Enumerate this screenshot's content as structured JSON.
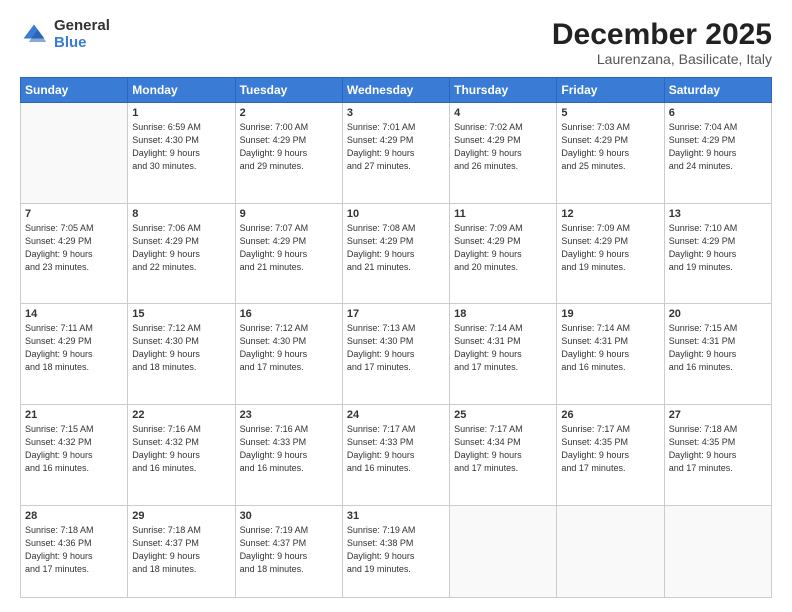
{
  "logo": {
    "general": "General",
    "blue": "Blue"
  },
  "header": {
    "month": "December 2025",
    "location": "Laurenzana, Basilicate, Italy"
  },
  "weekdays": [
    "Sunday",
    "Monday",
    "Tuesday",
    "Wednesday",
    "Thursday",
    "Friday",
    "Saturday"
  ],
  "weeks": [
    [
      {
        "day": "",
        "info": ""
      },
      {
        "day": "1",
        "info": "Sunrise: 6:59 AM\nSunset: 4:30 PM\nDaylight: 9 hours\nand 30 minutes."
      },
      {
        "day": "2",
        "info": "Sunrise: 7:00 AM\nSunset: 4:29 PM\nDaylight: 9 hours\nand 29 minutes."
      },
      {
        "day": "3",
        "info": "Sunrise: 7:01 AM\nSunset: 4:29 PM\nDaylight: 9 hours\nand 27 minutes."
      },
      {
        "day": "4",
        "info": "Sunrise: 7:02 AM\nSunset: 4:29 PM\nDaylight: 9 hours\nand 26 minutes."
      },
      {
        "day": "5",
        "info": "Sunrise: 7:03 AM\nSunset: 4:29 PM\nDaylight: 9 hours\nand 25 minutes."
      },
      {
        "day": "6",
        "info": "Sunrise: 7:04 AM\nSunset: 4:29 PM\nDaylight: 9 hours\nand 24 minutes."
      }
    ],
    [
      {
        "day": "7",
        "info": "Sunrise: 7:05 AM\nSunset: 4:29 PM\nDaylight: 9 hours\nand 23 minutes."
      },
      {
        "day": "8",
        "info": "Sunrise: 7:06 AM\nSunset: 4:29 PM\nDaylight: 9 hours\nand 22 minutes."
      },
      {
        "day": "9",
        "info": "Sunrise: 7:07 AM\nSunset: 4:29 PM\nDaylight: 9 hours\nand 21 minutes."
      },
      {
        "day": "10",
        "info": "Sunrise: 7:08 AM\nSunset: 4:29 PM\nDaylight: 9 hours\nand 21 minutes."
      },
      {
        "day": "11",
        "info": "Sunrise: 7:09 AM\nSunset: 4:29 PM\nDaylight: 9 hours\nand 20 minutes."
      },
      {
        "day": "12",
        "info": "Sunrise: 7:09 AM\nSunset: 4:29 PM\nDaylight: 9 hours\nand 19 minutes."
      },
      {
        "day": "13",
        "info": "Sunrise: 7:10 AM\nSunset: 4:29 PM\nDaylight: 9 hours\nand 19 minutes."
      }
    ],
    [
      {
        "day": "14",
        "info": "Sunrise: 7:11 AM\nSunset: 4:29 PM\nDaylight: 9 hours\nand 18 minutes."
      },
      {
        "day": "15",
        "info": "Sunrise: 7:12 AM\nSunset: 4:30 PM\nDaylight: 9 hours\nand 18 minutes."
      },
      {
        "day": "16",
        "info": "Sunrise: 7:12 AM\nSunset: 4:30 PM\nDaylight: 9 hours\nand 17 minutes."
      },
      {
        "day": "17",
        "info": "Sunrise: 7:13 AM\nSunset: 4:30 PM\nDaylight: 9 hours\nand 17 minutes."
      },
      {
        "day": "18",
        "info": "Sunrise: 7:14 AM\nSunset: 4:31 PM\nDaylight: 9 hours\nand 17 minutes."
      },
      {
        "day": "19",
        "info": "Sunrise: 7:14 AM\nSunset: 4:31 PM\nDaylight: 9 hours\nand 16 minutes."
      },
      {
        "day": "20",
        "info": "Sunrise: 7:15 AM\nSunset: 4:31 PM\nDaylight: 9 hours\nand 16 minutes."
      }
    ],
    [
      {
        "day": "21",
        "info": "Sunrise: 7:15 AM\nSunset: 4:32 PM\nDaylight: 9 hours\nand 16 minutes."
      },
      {
        "day": "22",
        "info": "Sunrise: 7:16 AM\nSunset: 4:32 PM\nDaylight: 9 hours\nand 16 minutes."
      },
      {
        "day": "23",
        "info": "Sunrise: 7:16 AM\nSunset: 4:33 PM\nDaylight: 9 hours\nand 16 minutes."
      },
      {
        "day": "24",
        "info": "Sunrise: 7:17 AM\nSunset: 4:33 PM\nDaylight: 9 hours\nand 16 minutes."
      },
      {
        "day": "25",
        "info": "Sunrise: 7:17 AM\nSunset: 4:34 PM\nDaylight: 9 hours\nand 17 minutes."
      },
      {
        "day": "26",
        "info": "Sunrise: 7:17 AM\nSunset: 4:35 PM\nDaylight: 9 hours\nand 17 minutes."
      },
      {
        "day": "27",
        "info": "Sunrise: 7:18 AM\nSunset: 4:35 PM\nDaylight: 9 hours\nand 17 minutes."
      }
    ],
    [
      {
        "day": "28",
        "info": "Sunrise: 7:18 AM\nSunset: 4:36 PM\nDaylight: 9 hours\nand 17 minutes."
      },
      {
        "day": "29",
        "info": "Sunrise: 7:18 AM\nSunset: 4:37 PM\nDaylight: 9 hours\nand 18 minutes."
      },
      {
        "day": "30",
        "info": "Sunrise: 7:19 AM\nSunset: 4:37 PM\nDaylight: 9 hours\nand 18 minutes."
      },
      {
        "day": "31",
        "info": "Sunrise: 7:19 AM\nSunset: 4:38 PM\nDaylight: 9 hours\nand 19 minutes."
      },
      {
        "day": "",
        "info": ""
      },
      {
        "day": "",
        "info": ""
      },
      {
        "day": "",
        "info": ""
      }
    ]
  ]
}
